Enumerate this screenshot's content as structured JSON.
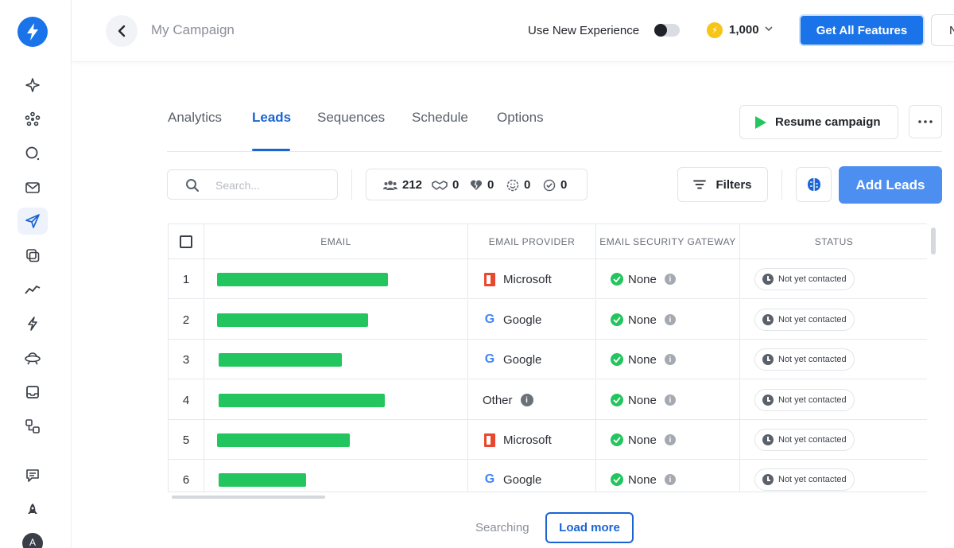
{
  "colors": {
    "accent": "#1a73e8",
    "tab_active": "#1a64d3",
    "add_leads": "#4d8ff0",
    "redaction_bar": "#22c55e"
  },
  "header": {
    "campaign_title": "My Campaign",
    "experience_label": "Use New Experience",
    "experience_toggle_on": false,
    "credits": "1,000",
    "get_features_label": "Get All Features",
    "extra_button_label": "N"
  },
  "sidebar": {
    "items": [
      {
        "icon": "sparkle-icon"
      },
      {
        "icon": "dots-grid-icon"
      },
      {
        "icon": "search-icon"
      },
      {
        "icon": "mail-icon"
      },
      {
        "icon": "send-icon",
        "active": true
      },
      {
        "icon": "copy-icon"
      },
      {
        "icon": "trend-icon"
      },
      {
        "icon": "bolt-icon"
      },
      {
        "icon": "ufo-icon"
      },
      {
        "icon": "inbox-icon"
      },
      {
        "icon": "flow-icon"
      },
      {
        "icon": "chat-icon"
      },
      {
        "icon": "rocket-icon"
      }
    ],
    "avatar_initial": "A"
  },
  "tabs": [
    {
      "label": "Analytics"
    },
    {
      "label": "Leads",
      "active": true
    },
    {
      "label": "Sequences"
    },
    {
      "label": "Schedule"
    },
    {
      "label": "Options"
    }
  ],
  "actions": {
    "resume_label": "Resume campaign"
  },
  "toolbar": {
    "search_placeholder": "Search...",
    "stats": [
      {
        "icon": "people-icon",
        "value": "212"
      },
      {
        "icon": "handshake-icon",
        "value": "0"
      },
      {
        "icon": "broken-heart-icon",
        "value": "0"
      },
      {
        "icon": "smiley-icon",
        "value": "0"
      },
      {
        "icon": "check-circle-icon",
        "value": "0"
      }
    ],
    "filters_label": "Filters",
    "add_leads_label": "Add Leads"
  },
  "table": {
    "columns": [
      "",
      "EMAIL",
      "EMAIL PROVIDER",
      "EMAIL SECURITY GATEWAY",
      "STATUS"
    ],
    "rows": [
      {
        "num": "1",
        "provider": "Microsoft",
        "provider_icon": "microsoft-icon",
        "gateway": "None",
        "status": "Not yet contacted"
      },
      {
        "num": "2",
        "provider": "Google",
        "provider_icon": "google-icon",
        "gateway": "None",
        "status": "Not yet contacted"
      },
      {
        "num": "3",
        "provider": "Google",
        "provider_icon": "google-icon",
        "gateway": "None",
        "status": "Not yet contacted"
      },
      {
        "num": "4",
        "provider": "Other",
        "provider_icon": "info-icon",
        "gateway": "None",
        "status": "Not yet contacted"
      },
      {
        "num": "5",
        "provider": "Microsoft",
        "provider_icon": "microsoft-icon",
        "gateway": "None",
        "status": "Not yet contacted"
      },
      {
        "num": "6",
        "provider": "Google",
        "provider_icon": "google-icon",
        "gateway": "None",
        "status": "Not yet contacted"
      }
    ]
  },
  "footer": {
    "searching_text": "Searching",
    "load_more_label": "Load more"
  }
}
